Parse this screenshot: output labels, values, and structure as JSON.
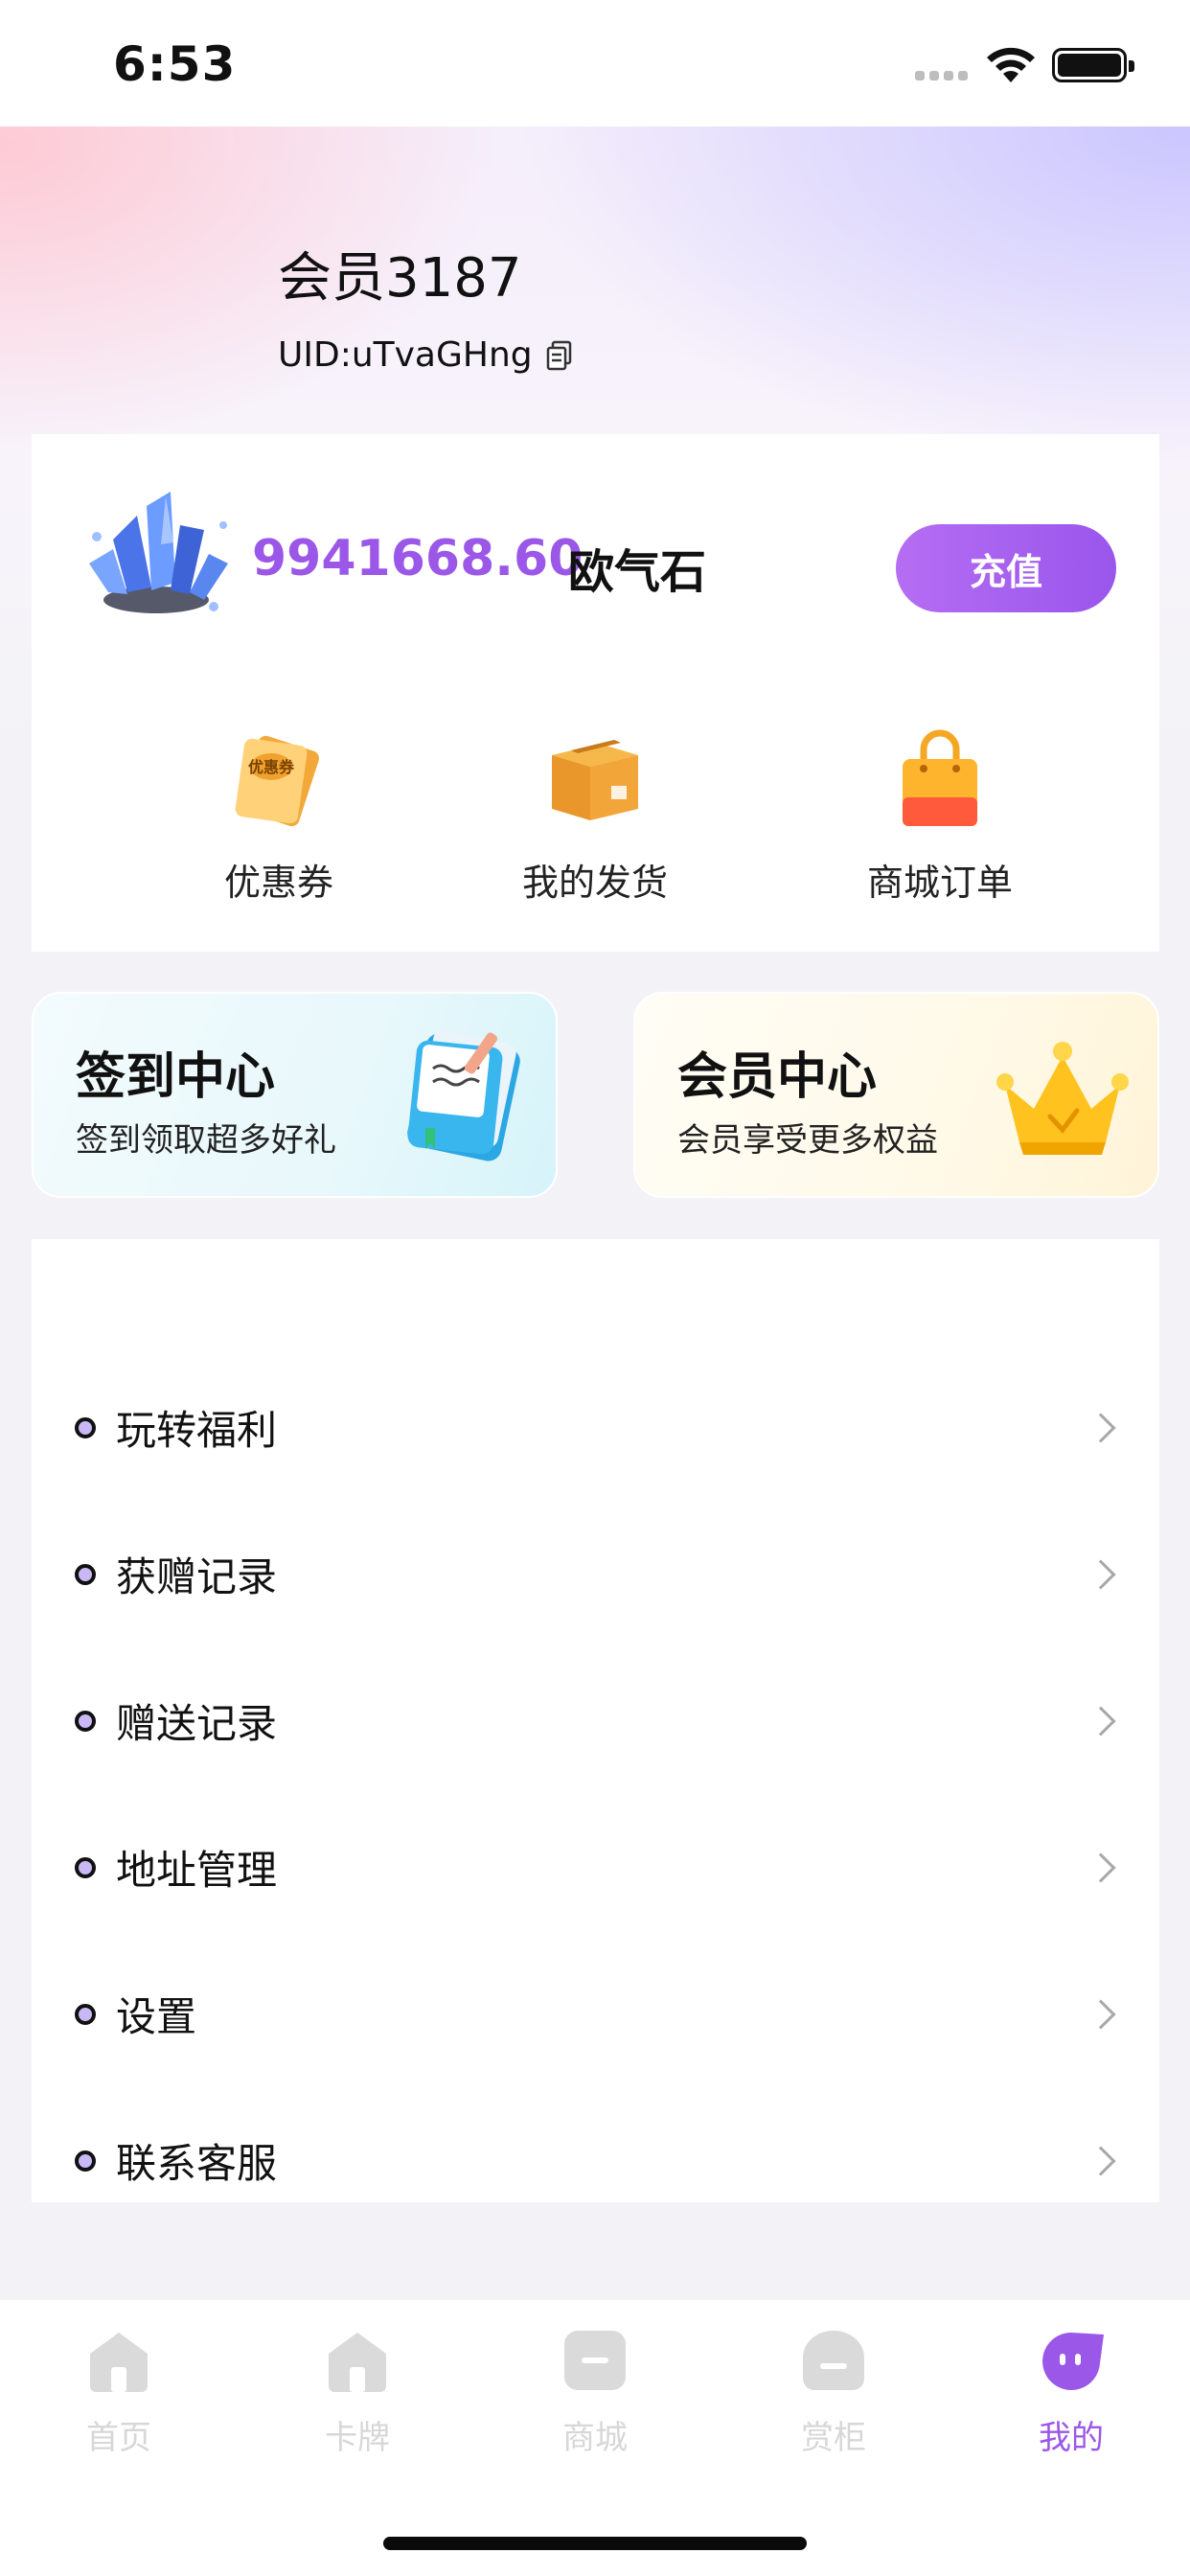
{
  "status_bar": {
    "time": "6:53"
  },
  "profile": {
    "name": "会员3187",
    "uid": "UID:uTvaGHng"
  },
  "wallet": {
    "balance": "9941668.60",
    "currency_name": "欧气石",
    "recharge_label": "充值"
  },
  "quick_actions": [
    {
      "label": "优惠券",
      "icon": "coupon-icon",
      "icon_text": "优惠券"
    },
    {
      "label": "我的发货",
      "icon": "package-icon"
    },
    {
      "label": "商城订单",
      "icon": "shopping-bag-icon"
    }
  ],
  "promos": {
    "checkin": {
      "title": "签到中心",
      "subtitle": "签到领取超多好礼",
      "icon": "book-icon"
    },
    "member": {
      "title": "会员中心",
      "subtitle": "会员享受更多权益",
      "icon": "crown-icon"
    }
  },
  "menu": [
    {
      "label": "玩转福利"
    },
    {
      "label": "获赠记录"
    },
    {
      "label": "赠送记录"
    },
    {
      "label": "地址管理"
    },
    {
      "label": "设置"
    },
    {
      "label": "联系客服"
    }
  ],
  "tabs": [
    {
      "label": "首页",
      "icon": "home-icon",
      "active": false
    },
    {
      "label": "卡牌",
      "icon": "cards-icon",
      "active": false
    },
    {
      "label": "商城",
      "icon": "mall-icon",
      "active": false
    },
    {
      "label": "赏柜",
      "icon": "cabinet-icon",
      "active": false
    },
    {
      "label": "我的",
      "icon": "profile-icon",
      "active": true
    }
  ],
  "colors": {
    "accent": "#9B57E8",
    "inactive_tab": "#D7D7D7",
    "background": "#F3F3F7"
  }
}
